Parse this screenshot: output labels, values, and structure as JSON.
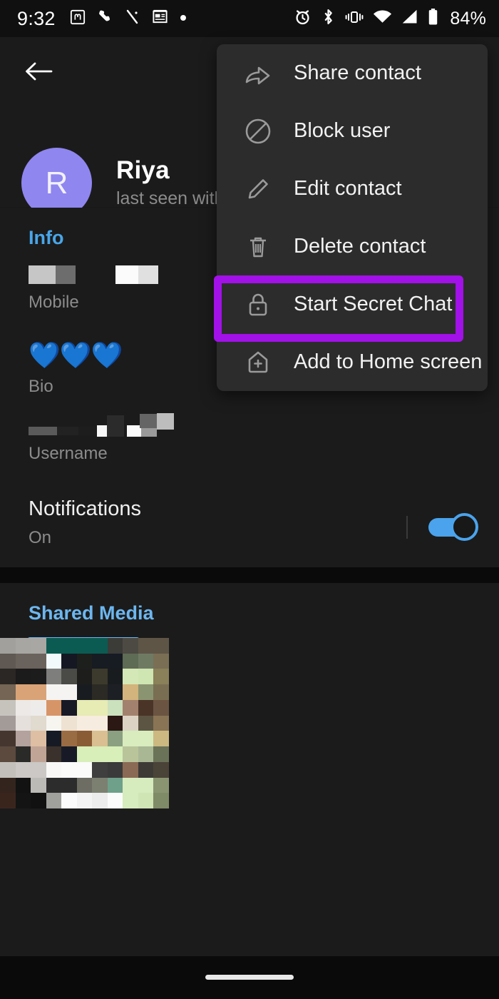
{
  "status_bar": {
    "time": "9:32",
    "battery_percent": "84%",
    "left_icons": [
      "mastodon-icon",
      "phone-call-icon",
      "silent-slash-icon",
      "news-app-icon",
      "dot-icon"
    ],
    "right_icons": [
      "alarm-icon",
      "bluetooth-icon",
      "vibrate-icon",
      "wifi-icon",
      "cellular-signal-icon",
      "battery-icon"
    ]
  },
  "header": {
    "back_label": "back-arrow",
    "avatar_initial": "R",
    "avatar_color": "#8f86f0",
    "name": "Riya",
    "status": "last seen with"
  },
  "info": {
    "section_title": "Info",
    "accent_color": "#49a6e8",
    "fields": [
      {
        "value": "",
        "label": "Mobile",
        "redacted": true
      },
      {
        "value": "💙💙💙",
        "label": "Bio",
        "redacted": false
      },
      {
        "value": "",
        "label": "Username",
        "redacted": true
      }
    ]
  },
  "notifications": {
    "title": "Notifications",
    "status": "On",
    "toggle_on": true,
    "toggle_color": "#4aa3ec"
  },
  "shared_media": {
    "section_title": "Shared Media",
    "accent_color": "#6cb6ef",
    "thumbnail": "pixelated-photo"
  },
  "menu": {
    "items": [
      {
        "label": "Share contact",
        "icon": "share-arrow-icon",
        "highlighted": false
      },
      {
        "label": "Block user",
        "icon": "block-circle-icon",
        "highlighted": false
      },
      {
        "label": "Edit contact",
        "icon": "pencil-icon",
        "highlighted": false
      },
      {
        "label": "Delete contact",
        "icon": "trash-icon",
        "highlighted": false
      },
      {
        "label": "Start Secret Chat",
        "icon": "lock-icon",
        "highlighted": true
      },
      {
        "label": "Add to Home screen",
        "icon": "home-plus-icon",
        "highlighted": false
      }
    ],
    "highlight_color": "#a211e8"
  },
  "bottom_nav": {
    "gesture_bar": "home-gesture-bar"
  }
}
